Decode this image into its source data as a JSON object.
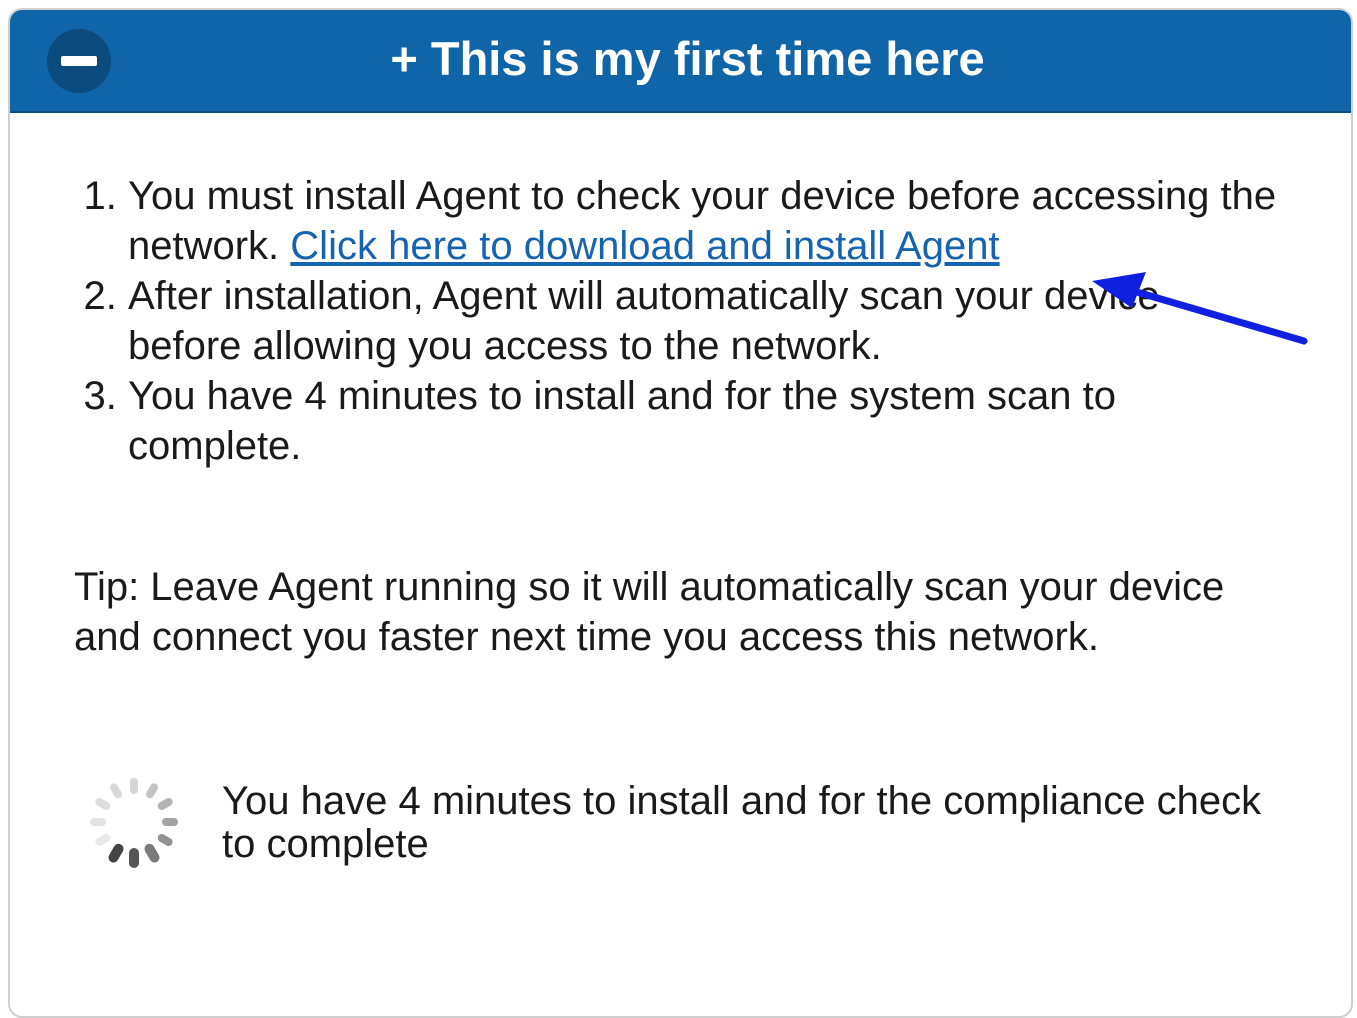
{
  "header": {
    "title": "+ This is my first time here",
    "collapse_icon": "minus-circle-icon"
  },
  "steps": [
    {
      "number": "1.",
      "text": "You must install Agent to check your device before accessing the network. ",
      "link_text": "Click here to download and install Agent"
    },
    {
      "number": "2.",
      "text": "After installation, Agent will automatically scan your device before allowing you access to the network."
    },
    {
      "number": "3.",
      "text": "You have 4 minutes to install and for the system scan to complete."
    }
  ],
  "tip": "Tip: Leave Agent running so it will automatically scan your device and connect you faster next time you access this network.",
  "timer": {
    "icon": "loading-spinner-icon",
    "message": "You have 4 minutes to install and for the compliance check to complete"
  },
  "colors": {
    "header_bg": "#0f65a8",
    "link": "#1663b0",
    "annotation_arrow": "#1020e0"
  }
}
